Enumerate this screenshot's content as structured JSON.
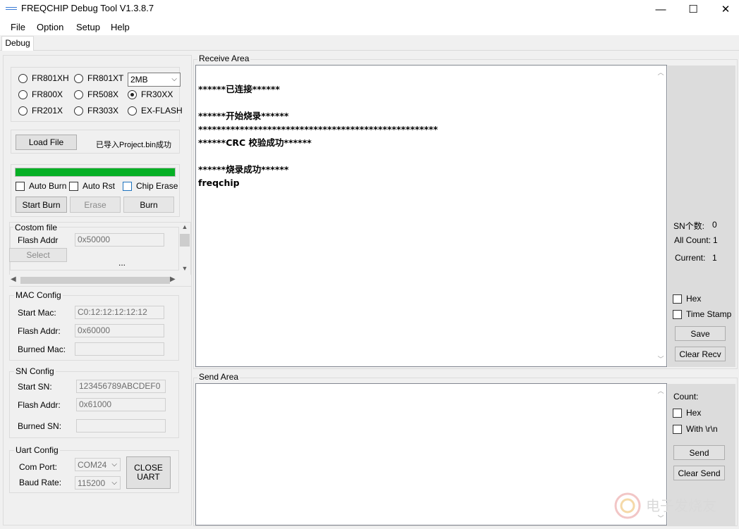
{
  "window": {
    "title": "FREQCHIP Debug Tool V1.3.8.7",
    "minimize": "—",
    "maximize": "☐",
    "close": "✕"
  },
  "menu": [
    "File",
    "Option",
    "Setup",
    "Help"
  ],
  "tabs": [
    "Debug"
  ],
  "chip_select": {
    "options": [
      {
        "label": "FR801XH",
        "selected": false
      },
      {
        "label": "FR801XT",
        "selected": false
      },
      {
        "label": "FR800X",
        "selected": false
      },
      {
        "label": "FR508X",
        "selected": false
      },
      {
        "label": "FR30XX",
        "selected": true
      },
      {
        "label": "FR201X",
        "selected": false
      },
      {
        "label": "FR303X",
        "selected": false
      },
      {
        "label": "EX-FLASH",
        "selected": false
      }
    ],
    "flash_size": "2MB"
  },
  "load": {
    "button": "Load File",
    "status": "已导入Project.bin成功"
  },
  "burn": {
    "progress": 1.0,
    "progress_color": "#06b025",
    "auto_burn": "Auto Burn",
    "auto_rst": "Auto Rst",
    "chip_erase": "Chip Erase",
    "start_burn": "Start Burn",
    "erase": "Erase",
    "burn": "Burn"
  },
  "custom_file": {
    "title": "Costom file",
    "flash_addr_label": "Flash Addr",
    "flash_addr_value": "0x50000",
    "select": "Select",
    "ellipsis": "..."
  },
  "mac_config": {
    "title": "MAC Config",
    "start_label": "Start Mac:",
    "start_value": "C0:12:12:12:12:12",
    "flash_label": "Flash Addr:",
    "flash_value": "0x60000",
    "burned_label": "Burned Mac:",
    "burned_value": ""
  },
  "sn_config": {
    "title": "SN Config",
    "start_label": "Start SN:",
    "start_value": "123456789ABCDEF0",
    "flash_label": "Flash Addr:",
    "flash_value": "0x61000",
    "burned_label": "Burned SN:",
    "burned_value": ""
  },
  "uart_config": {
    "title": "Uart Config",
    "port_label": "Com Port:",
    "port_value": "COM24",
    "baud_label": "Baud Rate:",
    "baud_value": "115200",
    "close_line1": "CLOSE",
    "close_line2": "UART"
  },
  "receive": {
    "title": "Receive Area",
    "lines": [
      "",
      "******已连接******",
      "",
      "******开始烧录******",
      "****************************************************",
      "******CRC 校验成功******",
      "",
      "******烧录成功******",
      "freqchip"
    ],
    "sn_count_label": "SN个数:",
    "sn_count_value": "0",
    "all_count_label": "All Count:",
    "all_count_value": "1",
    "current_label": "Current:",
    "current_value": "1",
    "hex": "Hex",
    "timestamp": "Time Stamp",
    "save": "Save",
    "clear": "Clear Recv"
  },
  "send": {
    "title": "Send Area",
    "count_label": "Count:",
    "hex": "Hex",
    "with_rn": "With \\r\\n",
    "send": "Send",
    "clear": "Clear Send"
  },
  "watermark": "电子发烧友"
}
